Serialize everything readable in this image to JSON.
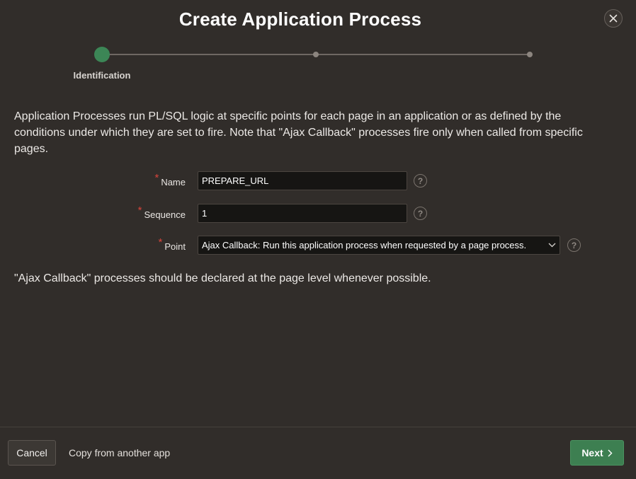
{
  "dialog": {
    "title": "Create Application Process",
    "close_icon": "close-icon"
  },
  "wizard": {
    "steps": [
      {
        "label": "Identification",
        "state": "current"
      },
      {
        "label": "",
        "state": "pending"
      },
      {
        "label": "",
        "state": "pending"
      }
    ],
    "current_color": "#3c8656"
  },
  "intro": "Application Processes run PL/SQL logic at specific points for each page in an application or as defined by the conditions under which they are set to fire. Note that \"Ajax Callback\" processes fire only when called from specific pages.",
  "form": {
    "name": {
      "label": "Name",
      "value": "PREPARE_URL",
      "required": true
    },
    "sequence": {
      "label": "Sequence",
      "value": "1",
      "required": true
    },
    "point": {
      "label": "Point",
      "value": "Ajax Callback: Run this application process when requested by a page process.",
      "required": true
    },
    "required_marker": "*",
    "help_glyph": "?"
  },
  "note": "\"Ajax Callback\" processes should be declared at the page level whenever possible.",
  "footer": {
    "cancel_label": "Cancel",
    "copy_label": "Copy from another app",
    "next_label": "Next"
  },
  "colors": {
    "background": "#312d2a",
    "primary": "#3d7f51",
    "required": "#d6443b"
  }
}
